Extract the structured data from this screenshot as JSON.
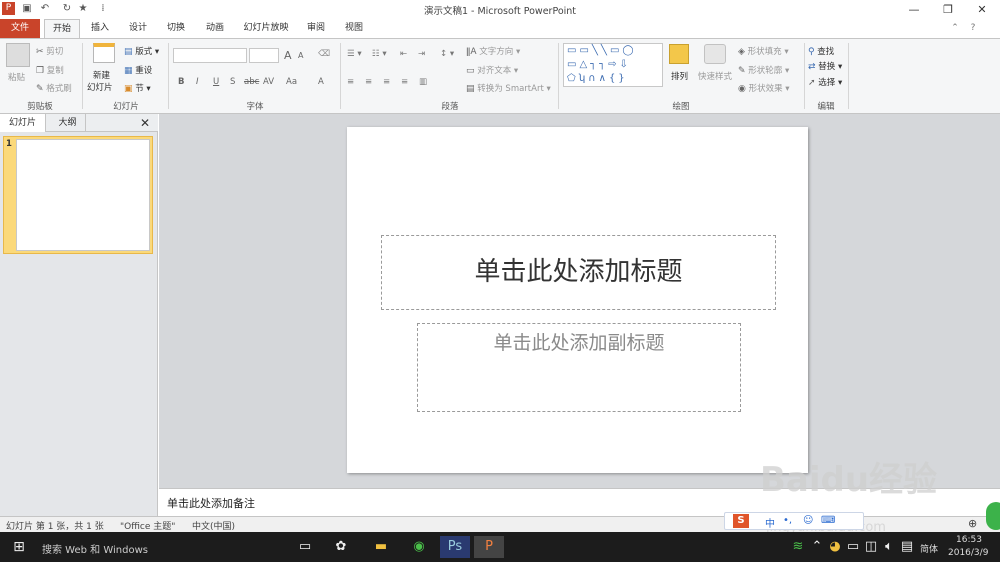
{
  "window": {
    "title": "演示文稿1 - Microsoft PowerPoint"
  },
  "tabs": [
    "文件",
    "开始",
    "插入",
    "设计",
    "切换",
    "动画",
    "幻灯片放映",
    "审阅",
    "视图"
  ],
  "ribbon": {
    "clipboard": {
      "paste": "粘贴",
      "cut": "剪切",
      "copy": "复制",
      "format_painter": "格式刷",
      "group": "剪贴板"
    },
    "slides": {
      "new_slide": "新建",
      "new_slide2": "幻灯片",
      "layout": "版式",
      "reset": "重设",
      "section": "节",
      "group": "幻灯片"
    },
    "font": {
      "group": "字体",
      "bold": "B",
      "italic": "I",
      "underline": "U",
      "strike": "S",
      "shadow": "abc",
      "spacing": "AV",
      "case": "Aa",
      "color": "A",
      "grow": "A",
      "shrink": "A"
    },
    "paragraph": {
      "text_direction": "文字方向",
      "align_text": "对齐文本",
      "smartart": "转换为 SmartArt",
      "group": "段落"
    },
    "drawing": {
      "arrange": "排列",
      "quick_styles": "快速样式",
      "shape_fill": "形状填充",
      "shape_outline": "形状轮廓",
      "shape_effects": "形状效果",
      "group": "绘图"
    },
    "editing": {
      "find": "查找",
      "replace": "替换",
      "select": "选择",
      "group": "编辑"
    }
  },
  "panel": {
    "tab_slides": "幻灯片",
    "tab_outline": "大纲",
    "slide_number": "1"
  },
  "slide": {
    "title_placeholder": "单击此处添加标题",
    "subtitle_placeholder": "单击此处添加副标题"
  },
  "notes": {
    "placeholder": "单击此处添加备注"
  },
  "status": {
    "slide_info": "幻灯片 第 1 张，共 1 张",
    "theme": "\"Office 主题\"",
    "language": "中文(中国)"
  },
  "taskbar": {
    "search": "搜索 Web 和 Windows",
    "ime": "简体",
    "time": "16:53",
    "date": "2016/3/9"
  },
  "watermark": {
    "text": "Baidu经验",
    "url": "jingyan.baidu.com"
  },
  "colors": {
    "file_tab": "#c9442a",
    "taskbar": "#1c1c1c",
    "selected_thumb": "#fbd97a"
  }
}
